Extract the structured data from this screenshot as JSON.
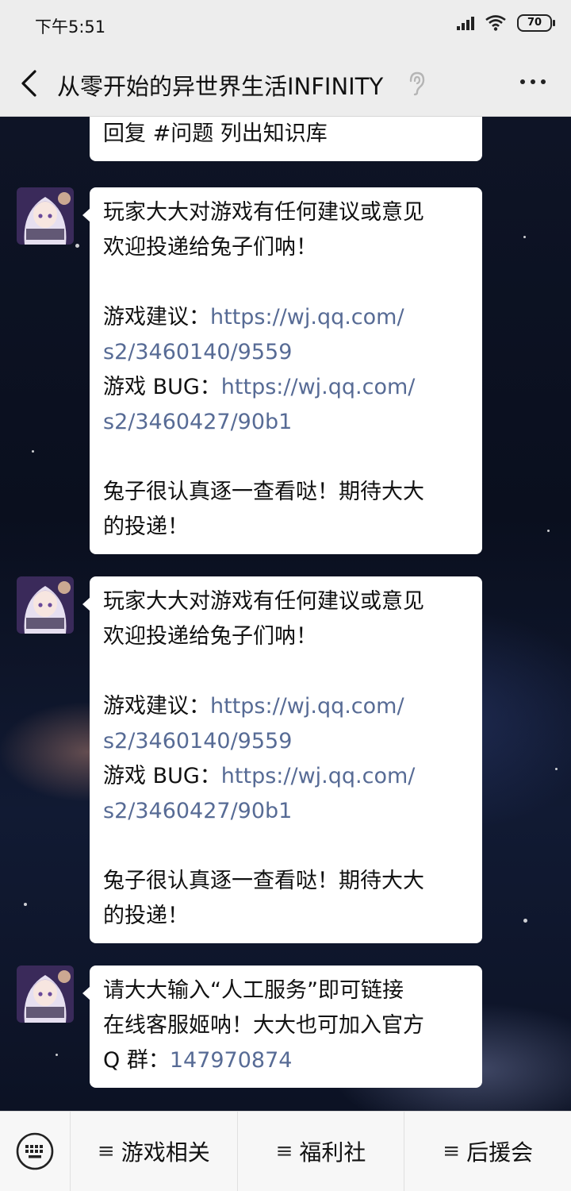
{
  "status_bar": {
    "time": "下午5:51",
    "battery": "70"
  },
  "nav": {
    "title": "从零开始的异世界生活INFINITY"
  },
  "messages": [
    {
      "lines": [
        "回复 #问题 列出知识库"
      ]
    },
    {
      "line1": "玩家大大对游戏有任何建议或意见",
      "line2": "欢迎投递给兔子们呐！",
      "suggest_label": "游戏建议：",
      "suggest_link_1": "https://wj.qq.com/",
      "suggest_link_2": "s2/3460140/9559",
      "bug_label": "游戏 BUG：",
      "bug_link_1": "https://wj.qq.com/",
      "bug_link_2": "s2/3460427/90b1",
      "end1": "兔子很认真逐一查看哒！期待大大",
      "end2": "的投递！"
    },
    {
      "line1": "玩家大大对游戏有任何建议或意见",
      "line2": "欢迎投递给兔子们呐！",
      "suggest_label": "游戏建议：",
      "suggest_link_1": "https://wj.qq.com/",
      "suggest_link_2": "s2/3460140/9559",
      "bug_label": "游戏 BUG：",
      "bug_link_1": "https://wj.qq.com/",
      "bug_link_2": "s2/3460427/90b1",
      "end1": "兔子很认真逐一查看哒！期待大大",
      "end2": "的投递！"
    },
    {
      "line1": "请大大输入“人工服务”即可链接",
      "line2": "在线客服姬呐！大大也可加入官方",
      "qq_label": "Q 群：",
      "qq_number": "147970874"
    }
  ],
  "menu": {
    "items": [
      {
        "label": "游戏相关"
      },
      {
        "label": "福利社"
      },
      {
        "label": "后援会"
      }
    ],
    "glyph": "≡"
  },
  "colors": {
    "link": "#576b95",
    "bar": "#ededed",
    "bubble": "#ffffff"
  }
}
